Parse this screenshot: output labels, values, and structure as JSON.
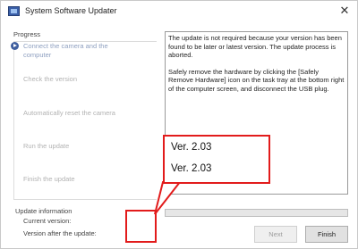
{
  "window": {
    "title": "System Software Updater",
    "close_glyph": "✕"
  },
  "progress": {
    "label": "Progress",
    "steps": [
      {
        "label": "Connect the camera and the computer",
        "state": "current"
      },
      {
        "label": "Check the version",
        "state": "pending"
      },
      {
        "label": "Automatically reset the camera",
        "state": "pending"
      },
      {
        "label": "Run the update",
        "state": "pending"
      },
      {
        "label": "Finish the update",
        "state": "pending"
      }
    ]
  },
  "message": {
    "paragraph1": "The update is not required because your version has been found to be later or latest version. The update process is aborted.",
    "paragraph2": "Safely remove the hardware by clicking the [Safely Remove Hardware] icon on the task tray at the bottom right of the computer screen, and disconnect the USB plug."
  },
  "update_info": {
    "label": "Update information",
    "current_version_label": "Current version:",
    "after_update_label": "Version after the update:"
  },
  "buttons": {
    "next": "Next",
    "finish": "Finish"
  },
  "callout": {
    "current_version": "Ver. 2.03",
    "after_version": "Ver. 2.03",
    "color": "#e21b1b"
  },
  "colors": {
    "step_arrow": "#3f5e9e"
  }
}
